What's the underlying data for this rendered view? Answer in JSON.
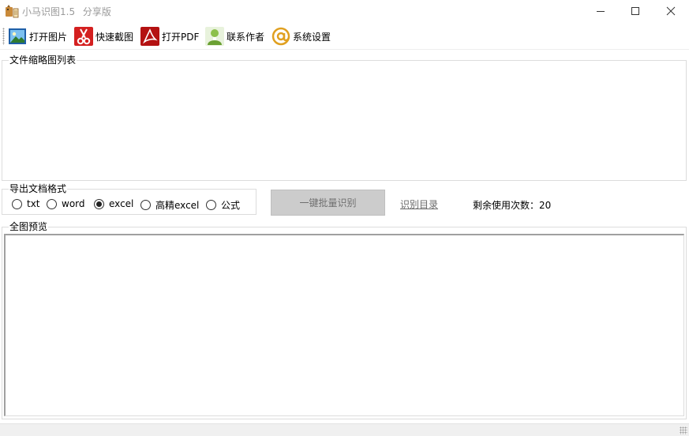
{
  "window": {
    "title": "小马识图1.5",
    "edition": "分享版"
  },
  "toolbar": {
    "items": [
      {
        "label": "打开图片",
        "icon": "image-icon"
      },
      {
        "label": "快速截图",
        "icon": "scissors-icon"
      },
      {
        "label": "打开PDF",
        "icon": "pdf-icon"
      },
      {
        "label": "联系作者",
        "icon": "contact-person-icon"
      },
      {
        "label": "系统设置",
        "icon": "at-sign-icon"
      }
    ]
  },
  "thumbnails": {
    "label": "文件缩略图列表"
  },
  "export": {
    "label": "导出文档格式",
    "options": [
      {
        "label": "txt",
        "selected": false
      },
      {
        "label": "word",
        "selected": false
      },
      {
        "label": "excel",
        "selected": true
      },
      {
        "label": "高精excel",
        "selected": false
      },
      {
        "label": "公式",
        "selected": false
      }
    ]
  },
  "batch_button": {
    "label": "一键批量识别"
  },
  "directory_link": {
    "label": "识别目录"
  },
  "remaining": {
    "text": "剩余使用次数：20"
  },
  "preview": {
    "label": "全图预览"
  },
  "colors": {
    "disabled_button_bg": "#cccccc",
    "group_border": "#dcdcdc",
    "title_text": "#9a9a9a"
  }
}
